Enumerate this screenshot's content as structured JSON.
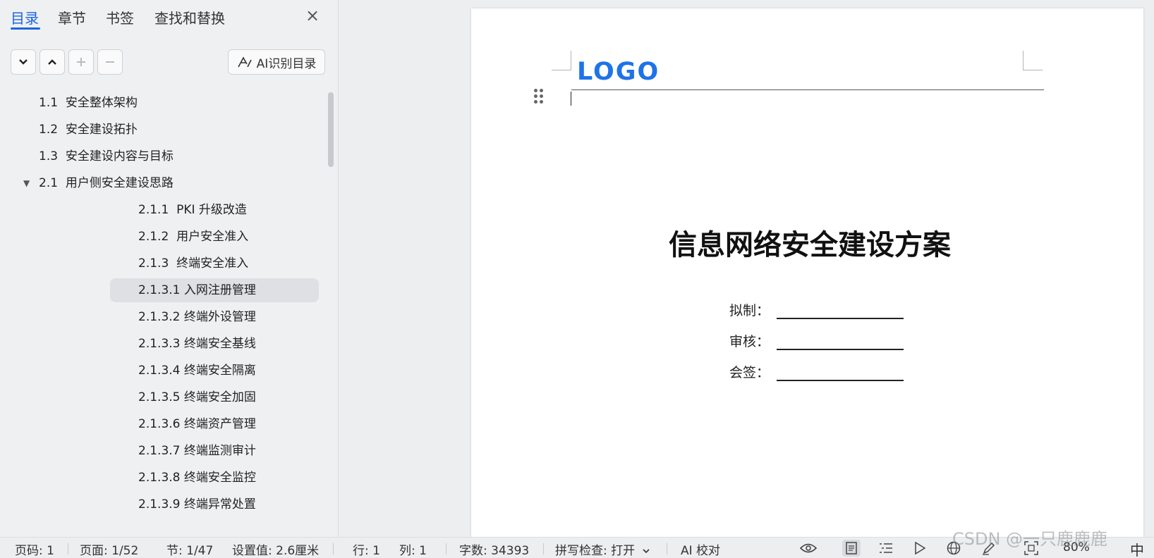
{
  "sidebar": {
    "tabs": [
      "目录",
      "章节",
      "书签",
      "查找和替换"
    ],
    "ai_toc_label": "AI识别目录",
    "toc": [
      {
        "num": "1.1",
        "title": "安全整体架构"
      },
      {
        "num": "1.2",
        "title": "安全建设拓扑"
      },
      {
        "num": "1.3",
        "title": "安全建设内容与目标"
      },
      {
        "num": "2.1",
        "title": "用户侧安全建设思路"
      },
      {
        "num": "2.1.1",
        "title": "PKI 升级改造"
      },
      {
        "num": "2.1.2",
        "title": "用户安全准入"
      },
      {
        "num": "2.1.3",
        "title": "终端安全准入"
      },
      {
        "num": "2.1.3.1",
        "title": "入网注册管理"
      },
      {
        "num": "2.1.3.2",
        "title": "终端外设管理"
      },
      {
        "num": "2.1.3.3",
        "title": "终端安全基线"
      },
      {
        "num": "2.1.3.4",
        "title": "终端安全隔离"
      },
      {
        "num": "2.1.3.5",
        "title": "终端安全加固"
      },
      {
        "num": "2.1.3.6",
        "title": "终端资产管理"
      },
      {
        "num": "2.1.3.7",
        "title": "终端监测审计"
      },
      {
        "num": "2.1.3.8",
        "title": "终端安全监控"
      },
      {
        "num": "2.1.3.9",
        "title": "终端异常处置"
      }
    ]
  },
  "document": {
    "logo": "LOGO",
    "title": "信息网络安全建设方案",
    "sign_rows": [
      "拟制：",
      "审核：",
      "会签："
    ]
  },
  "status": {
    "page_num": "页码: 1",
    "page": "页面: 1/52",
    "section": "节: 1/47",
    "setting": "设置值: 2.6厘米",
    "row": "行: 1",
    "col": "列: 1",
    "word_count": "字数: 34393",
    "spell_check": "拼写检查: 打开",
    "ai_check": "AI 校对",
    "zoom": "80%",
    "ime": "中"
  },
  "watermark": "CSDN @一只鹿鹿鹿",
  "colors": {
    "accent": "#1a66e0",
    "logo": "#1f73e8"
  }
}
